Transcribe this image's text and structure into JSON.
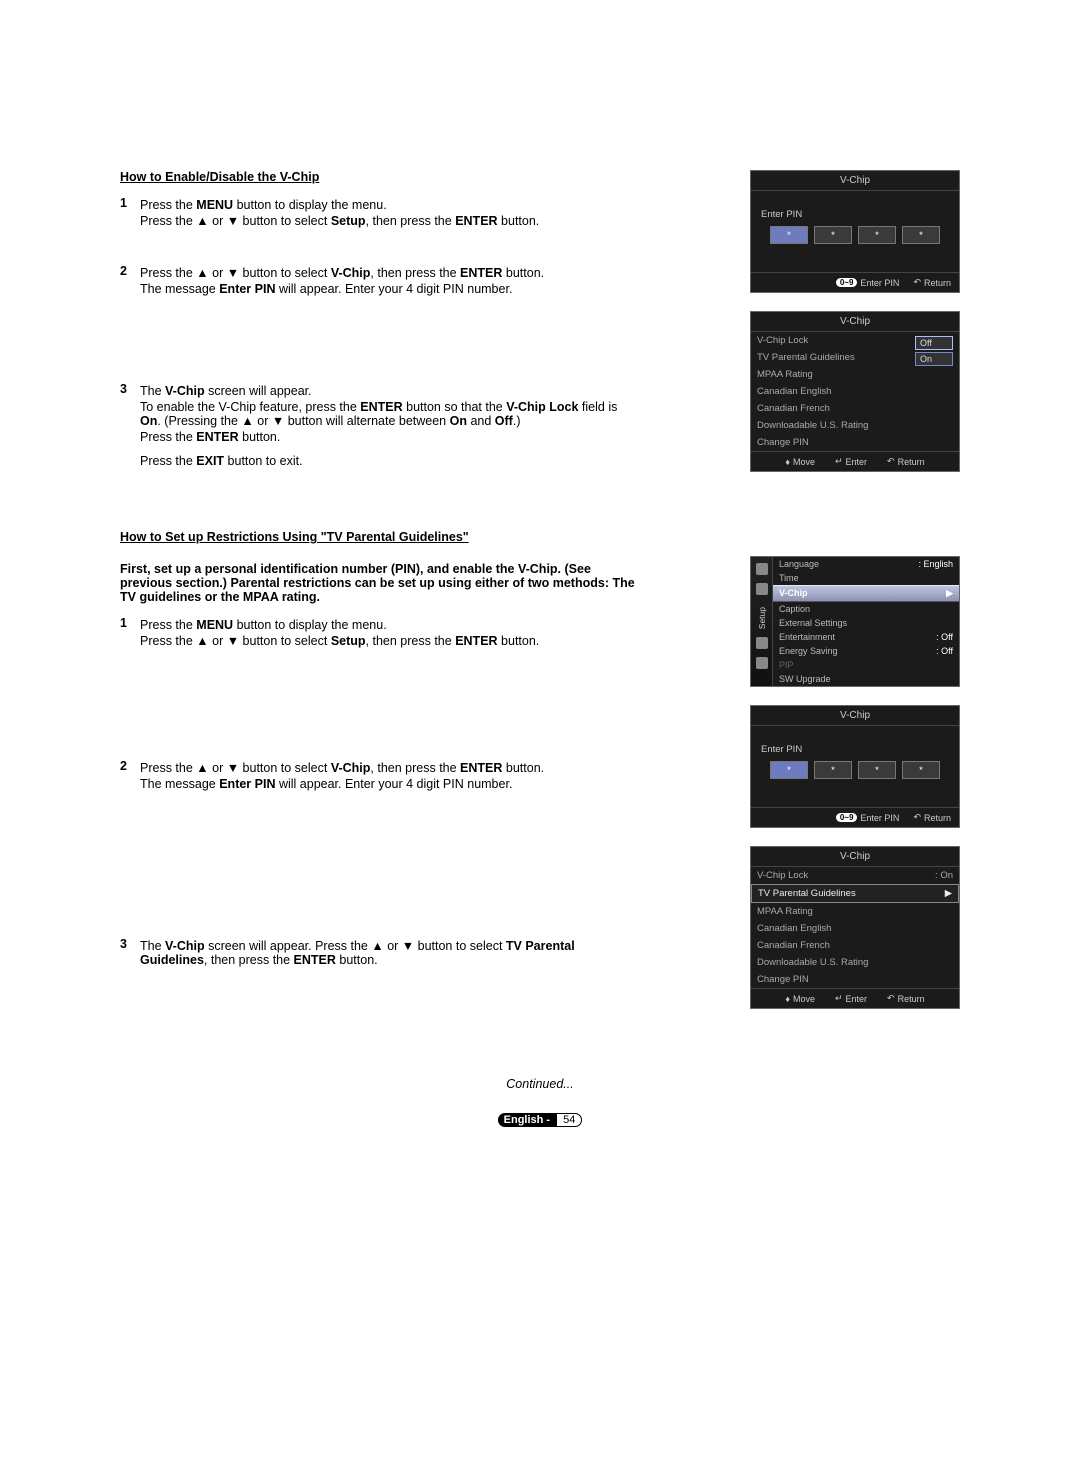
{
  "section1": {
    "title": "How to Enable/Disable the V-Chip",
    "steps": {
      "1": {
        "num": "1",
        "l1a": "Press the ",
        "l1b": "MENU",
        "l1c": " button to display the menu.",
        "l2a": "Press the ▲ or ▼ button to select ",
        "l2b": "Setup",
        "l2c": ", then press the ",
        "l2d": "ENTER",
        "l2e": " button."
      },
      "2": {
        "num": "2",
        "l1a": "Press the ▲ or ▼ button to select ",
        "l1b": "V-Chip",
        "l1c": ", then press the ",
        "l1d": "ENTER",
        "l1e": " button.",
        "l2a": "The message ",
        "l2b": "Enter PIN",
        "l2c": " will appear. Enter your 4 digit PIN number."
      },
      "3": {
        "num": "3",
        "l1a": "The ",
        "l1b": "V-Chip",
        "l1c": " screen will appear.",
        "l2a": "To enable the V-Chip feature, press the ",
        "l2b": "ENTER",
        "l2c": " button so that the ",
        "l2d": "V-Chip Lock",
        "l2e": " field is ",
        "l2f": "On",
        "l2g": ". (Pressing the ▲ or ▼ button will alternate between ",
        "l2h": "On",
        "l2i": " and ",
        "l2j": "Off",
        "l2k": ".)",
        "l3a": "Press the ",
        "l3b": "ENTER",
        "l3c": " button.",
        "l4a": "Press the ",
        "l4b": "EXIT",
        "l4c": " button to exit."
      }
    }
  },
  "section2": {
    "title": "How to Set up Restrictions Using \"TV Parental Guidelines\"",
    "intro": "First, set up a personal identification number (PIN), and enable the V-Chip. (See previous section.) Parental restrictions can be set up using either of two methods: The TV guidelines or the MPAA rating.",
    "steps": {
      "1": {
        "num": "1",
        "l1a": "Press the ",
        "l1b": "MENU",
        "l1c": " button to display the menu.",
        "l2a": "Press the ▲ or ▼ button to select ",
        "l2b": "Setup",
        "l2c": ", then press the ",
        "l2d": "ENTER",
        "l2e": " button."
      },
      "2": {
        "num": "2",
        "l1a": "Press the ▲ or ▼ button to select ",
        "l1b": "V-Chip",
        "l1c": ", then press the ",
        "l1d": "ENTER",
        "l1e": " button.",
        "l2a": "The message ",
        "l2b": "Enter PIN",
        "l2c": " will appear. Enter your 4 digit PIN number."
      },
      "3": {
        "num": "3",
        "l1a": "The ",
        "l1b": "V-Chip",
        "l1c": " screen will appear. Press the ▲ or ▼ button to select ",
        "l1d": "TV Parental Guidelines",
        "l1e": ", then press the ",
        "l1f": "ENTER",
        "l1g": " button."
      }
    }
  },
  "osd": {
    "pin": {
      "title": "V-Chip",
      "label": "Enter PIN",
      "dot": "*",
      "footer_enter": "Enter PIN",
      "footer_return": "Return",
      "badge": "0~9",
      "return_icon": "↶"
    },
    "vchipLock": {
      "title": "V-Chip",
      "items": [
        "V-Chip Lock",
        "TV Parental Guidelines",
        "MPAA Rating",
        "Canadian English",
        "Canadian French",
        "Downloadable U.S. Rating",
        "Change PIN"
      ],
      "valOff": "Off",
      "valOn": "On",
      "footer_move": "Move",
      "footer_enter": "Enter",
      "footer_return": "Return",
      "move_icon": "♦",
      "enter_icon": "↵",
      "return_icon": "↶"
    },
    "setup": {
      "sidebar_label": "Setup",
      "rows": [
        {
          "label": "Language",
          "val": ": English"
        },
        {
          "label": "Time",
          "val": ""
        },
        {
          "label": "V-Chip",
          "val": "▶",
          "hl": true
        },
        {
          "label": "Caption",
          "val": ""
        },
        {
          "label": "External Settings",
          "val": ""
        },
        {
          "label": "Entertainment",
          "val": ": Off"
        },
        {
          "label": "Energy Saving",
          "val": ": Off"
        },
        {
          "label": "PIP",
          "val": "",
          "dim": true
        },
        {
          "label": "SW Upgrade",
          "val": ""
        }
      ]
    },
    "vchipParental": {
      "title": "V-Chip",
      "lockLabel": "V-Chip Lock",
      "lockVal": ": On",
      "items": [
        "TV Parental Guidelines",
        "MPAA Rating",
        "Canadian English",
        "Canadian French",
        "Downloadable U.S. Rating",
        "Change PIN"
      ],
      "arrow": "▶",
      "footer_move": "Move",
      "footer_enter": "Enter",
      "footer_return": "Return",
      "move_icon": "♦",
      "enter_icon": "↵",
      "return_icon": "↶"
    }
  },
  "continued": "Continued...",
  "pagefoot": {
    "lang": "English - ",
    "num": "54"
  }
}
